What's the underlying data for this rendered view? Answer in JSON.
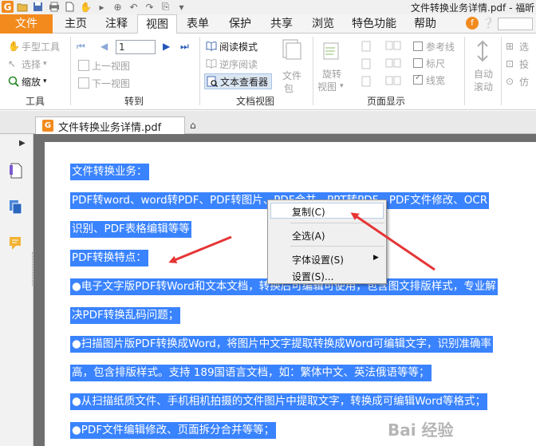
{
  "window": {
    "title": "文件转换业务详情.pdf - 福昕"
  },
  "menu": {
    "file": "文件",
    "tabs": [
      "主页",
      "注释",
      "视图",
      "表单",
      "保护",
      "共享",
      "浏览",
      "特色功能",
      "帮助"
    ],
    "active_tab": "视图"
  },
  "ribbon": {
    "tools": {
      "hand": "手型工具",
      "select": "选择",
      "zoom": "缩放",
      "group": "工具"
    },
    "goto": {
      "page_value": "1",
      "prev_view": "上一视图",
      "next_view": "下一视图",
      "group": "转到"
    },
    "docview": {
      "read_mode": "阅读模式",
      "reverse_read": "逆序阅读",
      "text_viewer": "文本查看器",
      "file_pack": "文件",
      "file_pack2": "包",
      "group": "文档视图"
    },
    "pagedisplay": {
      "rotate": "旋转",
      "rotate2": "视图",
      "ref_line": "参考线",
      "ruler": "标尺",
      "line_width": "线宽",
      "group": "页面显示"
    },
    "auto": {
      "auto": "自动",
      "scroll": "滚动",
      "sel": "选",
      "vote": "投",
      "imit": "仿"
    }
  },
  "doc_tab": {
    "name": "文件转换业务详情.pdf"
  },
  "page": {
    "lines": [
      "文件转换业务：",
      "PDF转word、word转PDF、PDF转图片、PDF合并、PPT转PDF、PDF文件修改、OCR",
      "识别、PDF表格编辑等等",
      "PDF转换特点：",
      "●电子文字版PDF转Word和文本文档，转换后可编辑可使用，包含图文排版样式，专业解",
      "决PDF转换乱码问题；",
      "●扫描图片版PDF转换成Word，将图片中文字提取转换成Word可编辑文字，识别准确率",
      "高，包含排版样式。支持 189国语言文档，如：繁体中文、英法俄语等等；",
      "●从扫描纸质文件、手机相机拍摄的文件图片中提取文字，转换成可编辑Word等格式；",
      "●PDF文件编辑修改、页面拆分合并等等；"
    ]
  },
  "context_menu": {
    "copy": "复制(C)",
    "select_all": "全选(A)",
    "font_settings": "字体设置(S)",
    "settings": "设置(S)..."
  },
  "watermark": "Bai 经验",
  "colors": {
    "accent_orange": "#f28a1d",
    "selection_blue": "#3a83ff",
    "arrow_red": "#e63535"
  }
}
